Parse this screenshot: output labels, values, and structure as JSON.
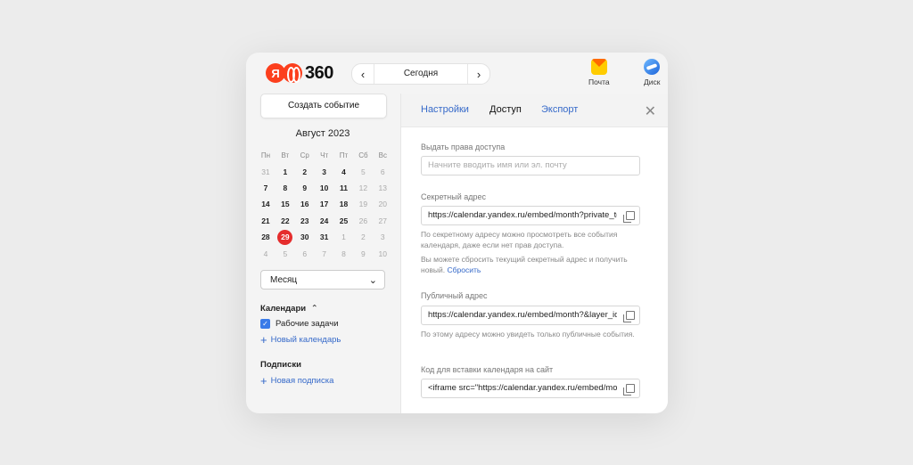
{
  "header": {
    "logo_letter": "Я",
    "logo_number": "360",
    "today_label": "Сегодня",
    "prev_arrow": "‹",
    "next_arrow": "›",
    "apps": [
      {
        "label": "Почта",
        "icon": "mail-icon"
      },
      {
        "label": "Диск",
        "icon": "disk-icon"
      }
    ]
  },
  "sidebar": {
    "create_button": "Создать событие",
    "month_title": "Август 2023",
    "weekdays": [
      "Пн",
      "Вт",
      "Ср",
      "Чт",
      "Пт",
      "Сб",
      "Вс"
    ],
    "weeks": [
      [
        "31",
        "1",
        "2",
        "3",
        "4",
        "5",
        "6"
      ],
      [
        "7",
        "8",
        "9",
        "10",
        "11",
        "12",
        "13"
      ],
      [
        "14",
        "15",
        "16",
        "17",
        "18",
        "19",
        "20"
      ],
      [
        "21",
        "22",
        "23",
        "24",
        "25",
        "26",
        "27"
      ],
      [
        "28",
        "29",
        "30",
        "31",
        "1",
        "2",
        "3"
      ],
      [
        "4",
        "5",
        "6",
        "7",
        "8",
        "9",
        "10"
      ]
    ],
    "selected_day": "29",
    "view_select": "Месяц",
    "calendars_title": "Календари",
    "calendars": [
      {
        "label": "Рабочие задачи",
        "checked": true,
        "color": "#3a7be8"
      }
    ],
    "new_calendar": "Новый календарь",
    "subscriptions_title": "Подписки",
    "new_subscription": "Новая подписка"
  },
  "panel": {
    "tabs": [
      "Настройки",
      "Доступ",
      "Экспорт"
    ],
    "active_tab": "Доступ",
    "access": {
      "label": "Выдать права доступа",
      "placeholder": "Начните вводить имя или эл. почту"
    },
    "secret": {
      "label": "Секретный адрес",
      "value": "https://calendar.yandex.ru/embed/month?private_token",
      "hint1": "По секретному адресу можно просмотреть все события календаря, даже если нет прав доступа.",
      "hint2": "Вы можете сбросить текущий секретный адрес и получить новый.",
      "reset_link": "Сбросить"
    },
    "public": {
      "label": "Публичный адрес",
      "value": "https://calendar.yandex.ru/embed/month?&layer_ids",
      "hint": "По этому адресу можно увидеть только публичные события."
    },
    "embed": {
      "label": "Код для вставки календаря на сайт",
      "value": "<iframe src=\"https://calendar.yandex.ru/embed/month"
    }
  },
  "colors": {
    "accent": "#3569c9",
    "selected_day": "#e52d2d",
    "brand": "#fc3f1d"
  }
}
